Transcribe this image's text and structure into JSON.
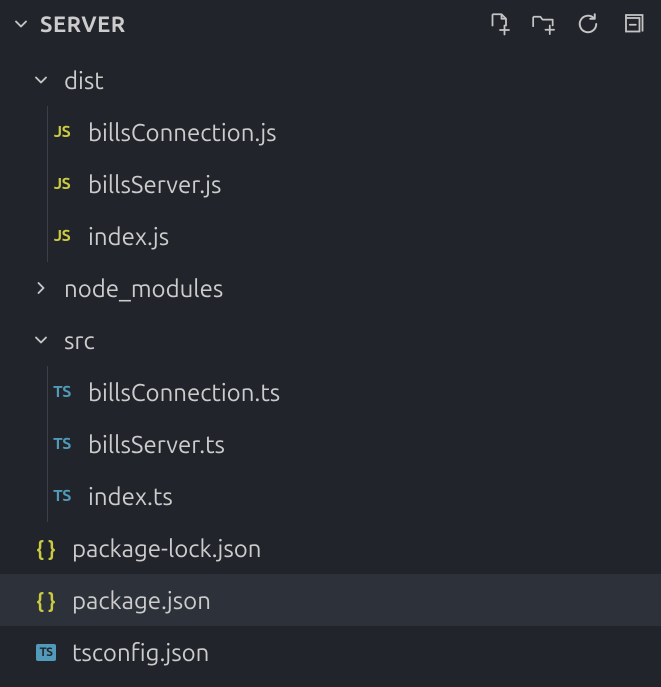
{
  "header": {
    "title": "SERVER"
  },
  "tree": {
    "dist": {
      "label": "dist",
      "children": {
        "billsConnection": {
          "label": "billsConnection.js",
          "icon": "JS"
        },
        "billsServer": {
          "label": "billsServer.js",
          "icon": "JS"
        },
        "index": {
          "label": "index.js",
          "icon": "JS"
        }
      }
    },
    "node_modules": {
      "label": "node_modules"
    },
    "src": {
      "label": "src",
      "children": {
        "billsConnection": {
          "label": "billsConnection.ts",
          "icon": "TS"
        },
        "billsServer": {
          "label": "billsServer.ts",
          "icon": "TS"
        },
        "index": {
          "label": "index.ts",
          "icon": "TS"
        }
      }
    },
    "packageLock": {
      "label": "package-lock.json",
      "icon": "{ }"
    },
    "package": {
      "label": "package.json",
      "icon": "{ }"
    },
    "tsconfig": {
      "label": "tsconfig.json",
      "icon": "TS"
    }
  }
}
